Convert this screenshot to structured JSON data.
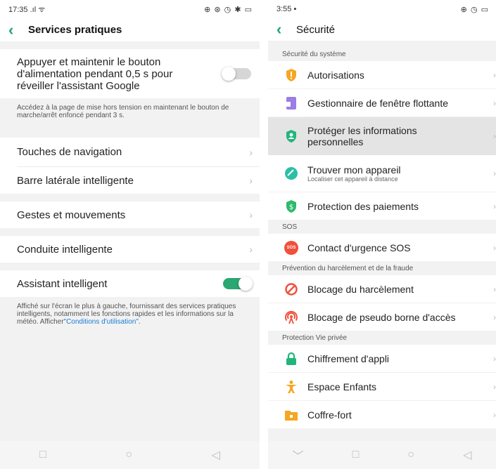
{
  "left": {
    "status": {
      "time": "17:35",
      "signal": ".ıl ᯤ",
      "icons": "⊕ ⊛ ◷ ✱ ▭"
    },
    "title": "Services pratiques",
    "power_row": {
      "label": "Appuyer et maintenir le bouton d'alimentation pendant 0,5 s pour réveiller l'assistant Google",
      "toggle": "off"
    },
    "power_note": "Accédez à la page de mise hors tension en maintenant le bouton de marche/arrêt enfoncé pendant 3 s.",
    "nav_items": [
      {
        "label": "Touches de navigation"
      },
      {
        "label": "Barre latérale intelligente"
      }
    ],
    "gestures": {
      "label": "Gestes et mouvements"
    },
    "driving": {
      "label": "Conduite intelligente"
    },
    "assistant_row": {
      "label": "Assistant intelligent",
      "toggle": "on"
    },
    "assistant_note": "Affiché sur l'écran le plus à gauche, fournissant des services pratiques intelligents, notamment les fonctions rapides et les informations sur la météo. Afficher",
    "assistant_link": "\"Conditions d'utilisation\"",
    "assistant_note_end": ".",
    "chevron": "›"
  },
  "right": {
    "status": {
      "time": "3:55",
      "icons": "⊕ ◷ ▭"
    },
    "title": "Sécurité",
    "sections": {
      "system": "Sécurité du système",
      "sos": "SOS",
      "fraud": "Prévention du harcèlement et de la fraude",
      "privacy": "Protection Vie privée"
    },
    "items": {
      "autorisations": "Autorisations",
      "floating": "Gestionnaire de fenêtre flottante",
      "protect_info": "Protéger les informations personnelles",
      "find_device": "Trouver mon appareil",
      "find_device_sub": "Localiser cet appareil à distance",
      "payments": "Protection des paiements",
      "sos_contact": "Contact d'urgence SOS",
      "harassment": "Blocage du harcèlement",
      "pseudo_station": "Blocage de pseudo borne d'accès",
      "app_encryption": "Chiffrement d'appli",
      "kids": "Espace Enfants",
      "safe": "Coffre-fort"
    },
    "sos_badge": "SOS",
    "chevron": "›"
  },
  "icons": {
    "accent": "#1ca37a",
    "toggle_on": "#2aa772",
    "link": "#1a7bd6"
  },
  "navbar": {
    "square": "□",
    "circle": "○",
    "back": "◁",
    "down": "﹀"
  }
}
